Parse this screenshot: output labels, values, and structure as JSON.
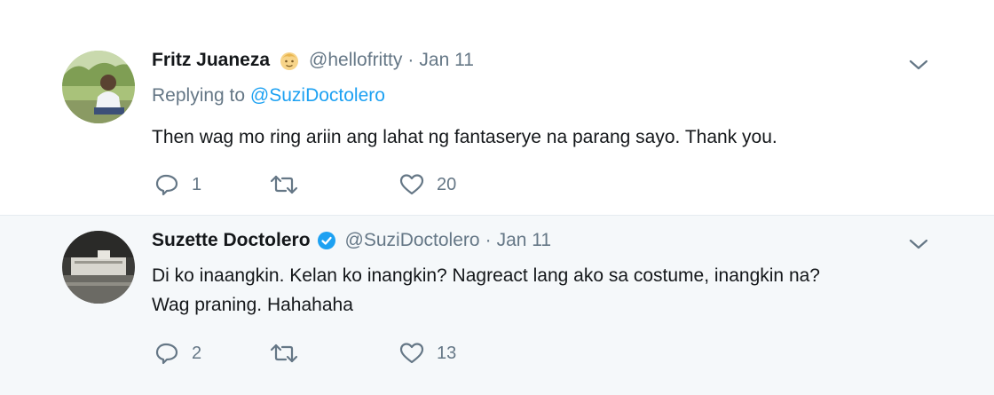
{
  "colors": {
    "link": "#1da1f2",
    "secondary_text": "#657786",
    "primary_text": "#14171a",
    "reply_background": "#f5f8fa",
    "thread_line": "#c4cfd6"
  },
  "tweets": [
    {
      "display_name": "Fritz Juaneza",
      "badge": "emoji-icon",
      "handle": "@hellofritty",
      "separator": "·",
      "time": "Jan 11",
      "replying_prefix": "Replying to ",
      "replying_to": "@SuziDoctolero",
      "text_lines": [
        "Then wag mo ring ariin ang lahat ng fantaserye na parang sayo. Thank you."
      ],
      "reply_count": "1",
      "retweet_count": "",
      "like_count": "20"
    },
    {
      "display_name": "Suzette Doctolero",
      "badge": "verified-icon",
      "handle": "@SuziDoctolero",
      "separator": "·",
      "time": "Jan 11",
      "text_lines": [
        "Di ko inaangkin. Kelan ko inangkin? Nagreact lang ako sa costume, inangkin na?",
        "Wag praning. Hahahaha"
      ],
      "reply_count": "2",
      "retweet_count": "",
      "like_count": "13"
    }
  ]
}
